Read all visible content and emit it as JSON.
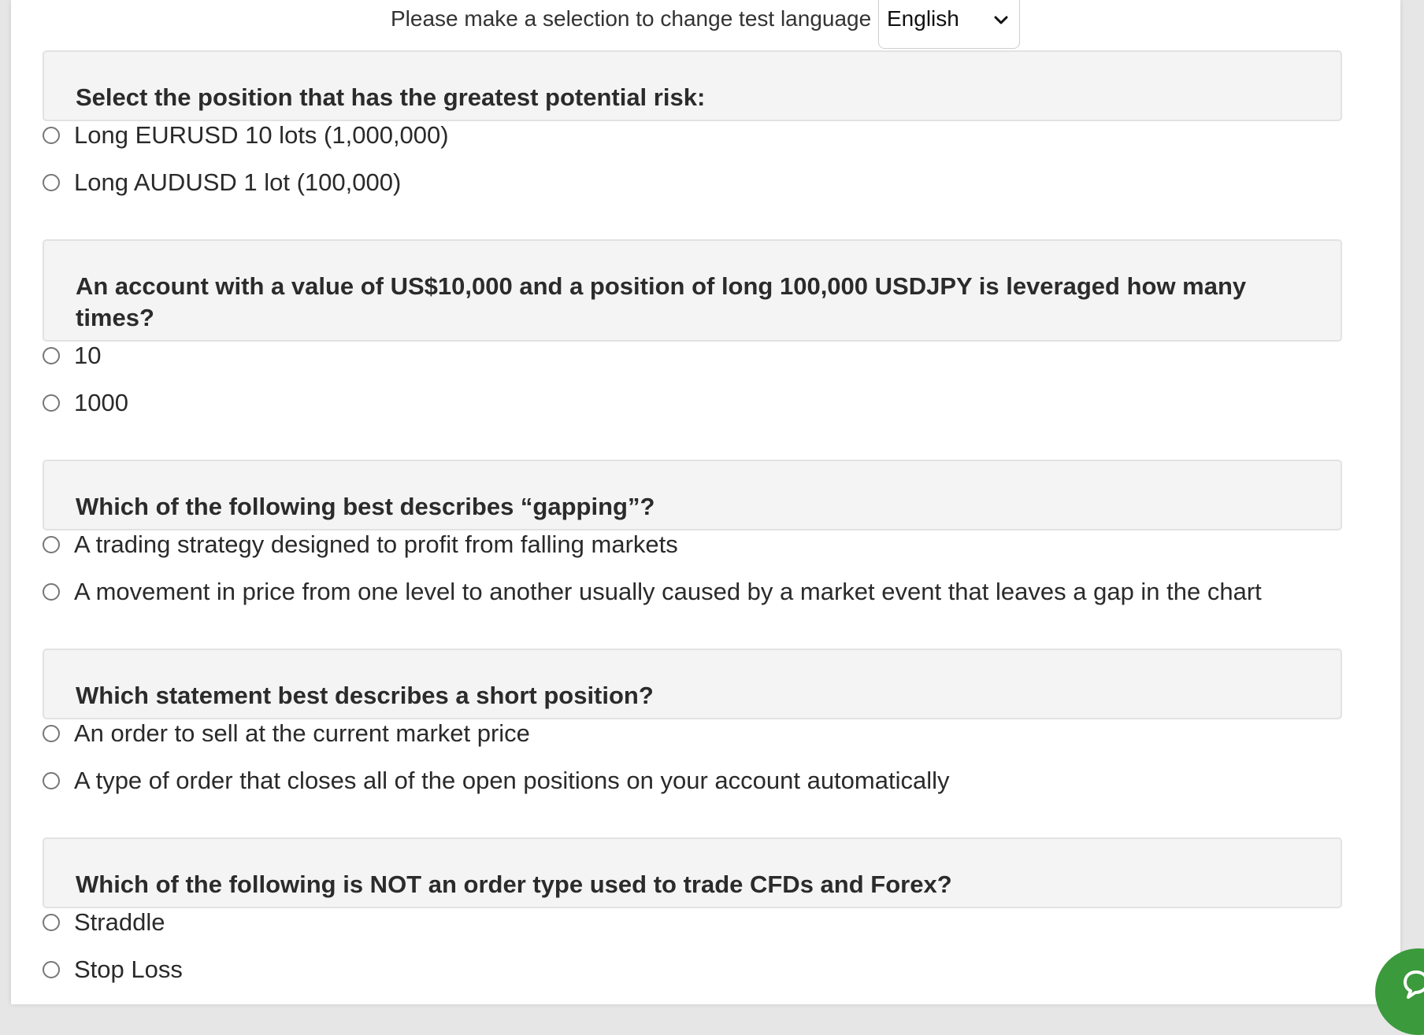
{
  "language_bar": {
    "prompt": "Please make a selection to change test language",
    "selected_language": "English"
  },
  "questions": [
    {
      "text": "Select the position that has the greatest potential risk:",
      "options": [
        "Long EURUSD 10 lots (1,000,000)",
        "Long AUDUSD 1 lot (100,000)"
      ]
    },
    {
      "text": "An account with a value of US$10,000 and a position of long 100,000 USDJPY is leveraged how many times?",
      "options": [
        "10",
        "1000"
      ]
    },
    {
      "text": "Which of the following best describes “gapping”?",
      "options": [
        "A trading strategy designed to profit from falling markets",
        "A movement in price from one level to another usually caused by a market event that leaves a gap in the chart"
      ]
    },
    {
      "text": "Which statement best describes a short position?",
      "options": [
        "An order to sell at the current market price",
        "A type of order that closes all of the open positions on your account automatically"
      ]
    },
    {
      "text": "Which of the following is NOT an order type used to trade CFDs and Forex?",
      "options": [
        "Straddle",
        "Stop Loss"
      ]
    }
  ],
  "chat_widget": {
    "icon": "chat-bubble-icon",
    "color": "#3b9a3b"
  }
}
